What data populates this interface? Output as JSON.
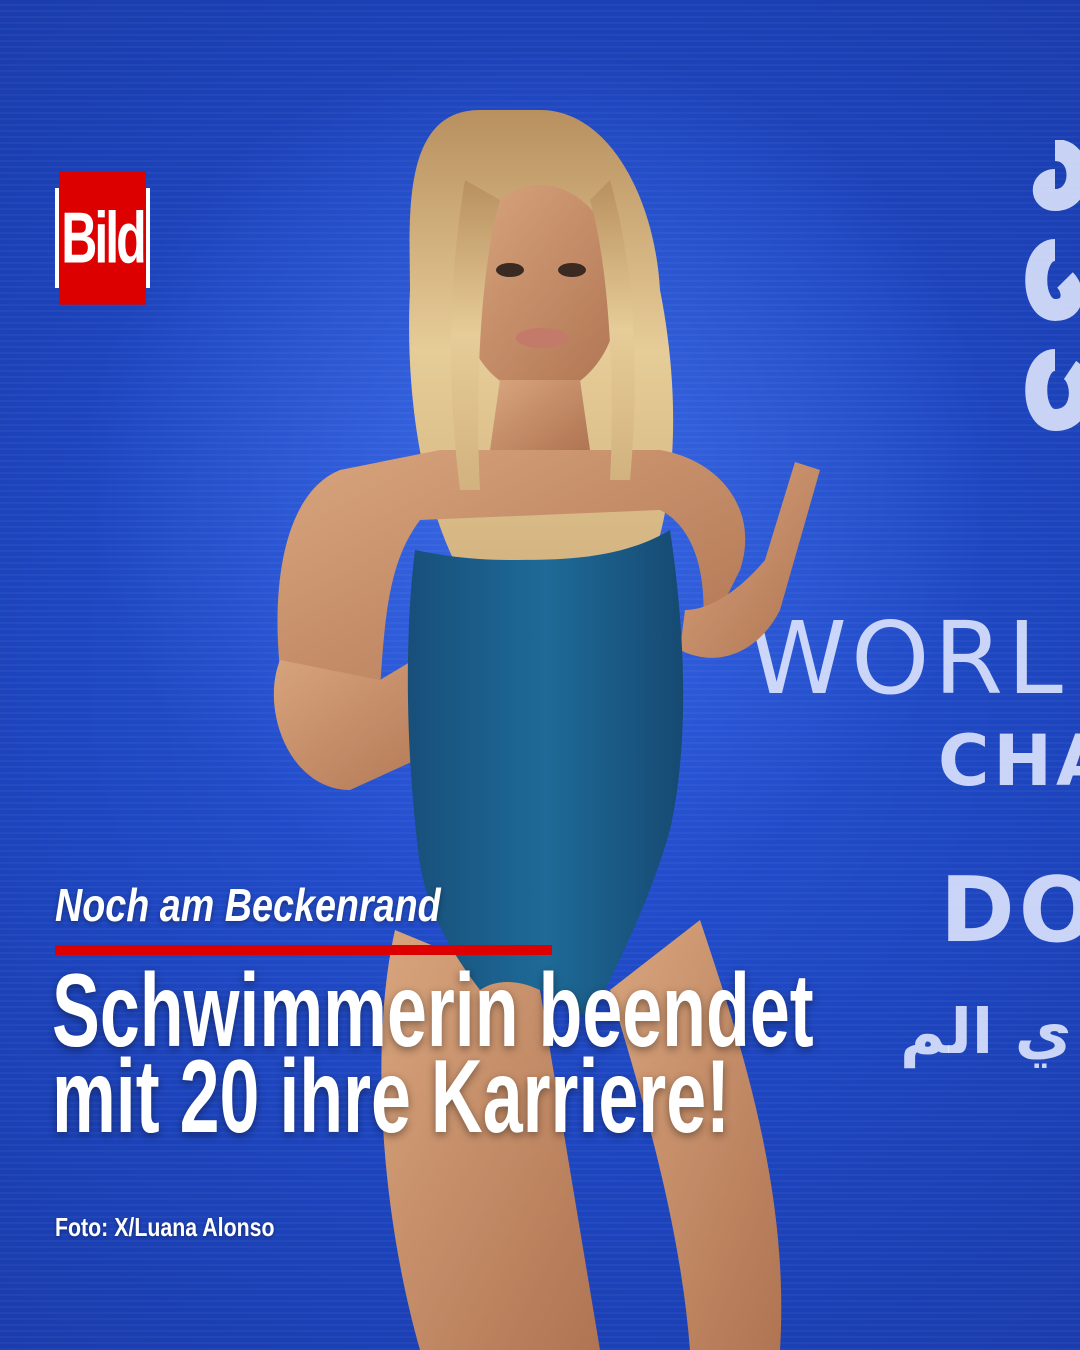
{
  "brand": {
    "logo_text": "Bild",
    "color": "#dd0000"
  },
  "article": {
    "kicker": "Noch am Beckenrand",
    "headline_line1": "Schwimmerin beendet",
    "headline_line2": "mit 20 ihre Karriere!",
    "photo_credit": "Foto: X/Luana Alonso"
  },
  "backdrop": {
    "word1": "WORL",
    "word2": "CHA",
    "word3": "DO",
    "word4": "ي الم",
    "colors": {
      "background": "#1f48c4",
      "swimsuit": "#1c6390"
    }
  }
}
